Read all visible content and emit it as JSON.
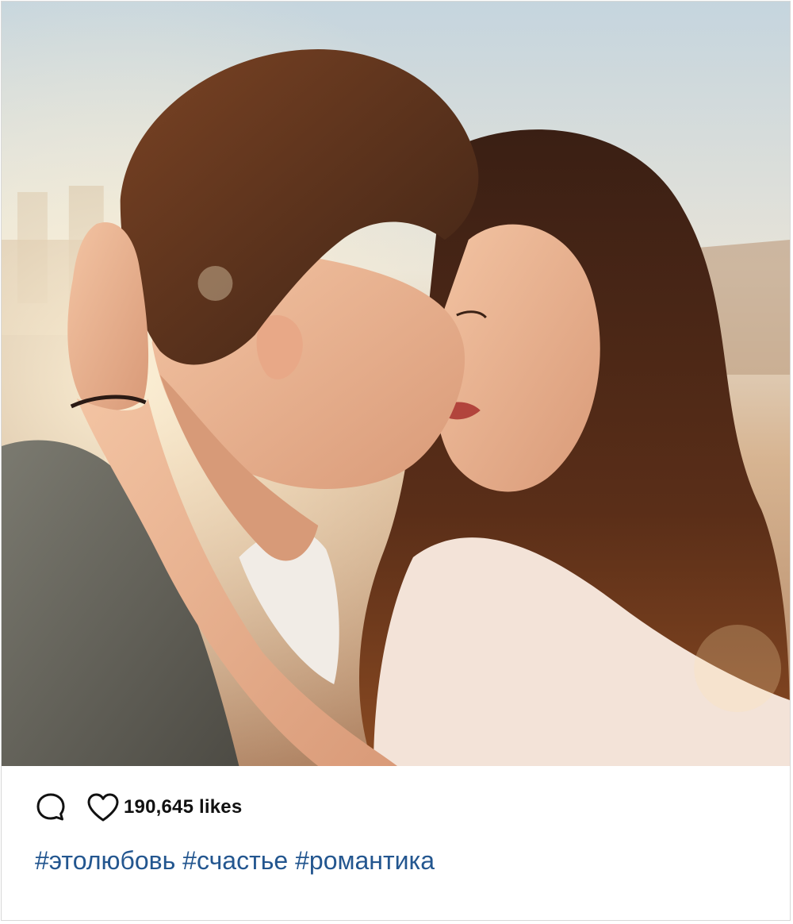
{
  "post": {
    "photo_alt": "",
    "actions": {
      "comment_icon": "comment-icon",
      "like_icon": "heart-icon"
    },
    "likes": "190,645 likes",
    "hashtags": [
      "#этолюбовь",
      "#счастье",
      "#романтика"
    ]
  },
  "colors": {
    "hashtag": "#23568f",
    "likes_text": "#111111",
    "icon_stroke": "#111111",
    "card_border": "#d8d8d8"
  }
}
